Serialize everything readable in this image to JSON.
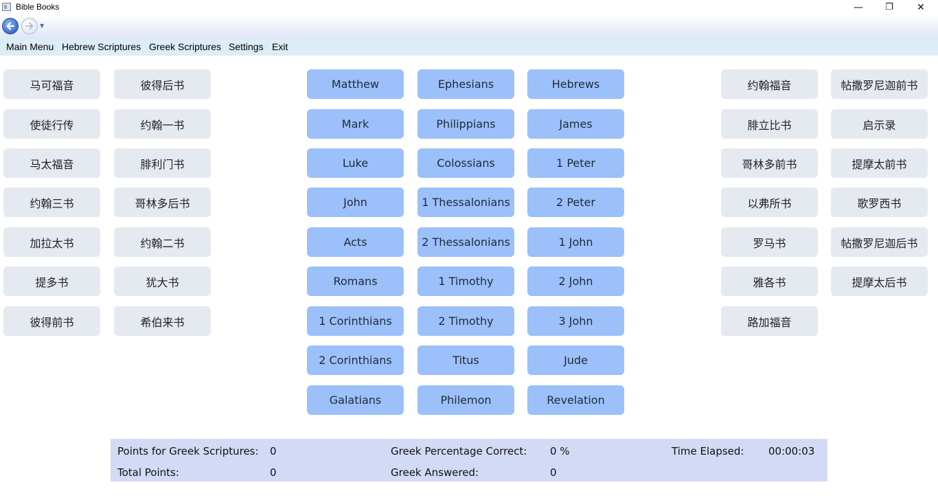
{
  "window": {
    "title": "Bible Books",
    "minimize": "—",
    "maximize": "❐",
    "close": "✕"
  },
  "menu": [
    "Main Menu",
    "Hebrew Scriptures",
    "Greek Scriptures",
    "Settings",
    "Exit"
  ],
  "chinese_left": {
    "col1": [
      "马可福音",
      "使徒行传",
      "马太福音",
      "约翰三书",
      "加拉太书",
      "提多书",
      "彼得前书"
    ],
    "col2": [
      "彼得后书",
      "约翰一书",
      "腓利门书",
      "哥林多后书",
      "约翰二书",
      "犹大书",
      "希伯来书"
    ]
  },
  "english": {
    "col1": [
      "Matthew",
      "Mark",
      "Luke",
      "John",
      "Acts",
      "Romans",
      "1 Corinthians",
      "2 Corinthians",
      "Galatians"
    ],
    "col2": [
      "Ephesians",
      "Philippians",
      "Colossians",
      "1 Thessalonians",
      "2 Thessalonians",
      "1 Timothy",
      "2 Timothy",
      "Titus",
      "Philemon"
    ],
    "col3": [
      "Hebrews",
      "James",
      "1 Peter",
      "2 Peter",
      "1 John",
      "2 John",
      "3 John",
      "Jude",
      "Revelation"
    ]
  },
  "chinese_right": {
    "col1": [
      "约翰福音",
      "腓立比书",
      "哥林多前书",
      "以弗所书",
      "罗马书",
      "雅各书",
      "路加福音"
    ],
    "col2": [
      "帖撒罗尼迦前书",
      "启示录",
      "提摩太前书",
      "歌罗西书",
      "帖撒罗尼迦后书",
      "提摩太后书"
    ]
  },
  "status": {
    "points_greek_label": "Points for Greek Scriptures:",
    "points_greek_value": "0",
    "total_points_label": "Total Points:",
    "total_points_value": "0",
    "greek_pct_label": "Greek Percentage Correct:",
    "greek_pct_value": "0 %",
    "greek_answered_label": "Greek Answered:",
    "greek_answered_value": "0",
    "time_label": "Time Elapsed:",
    "time_value": "00:00:03"
  }
}
